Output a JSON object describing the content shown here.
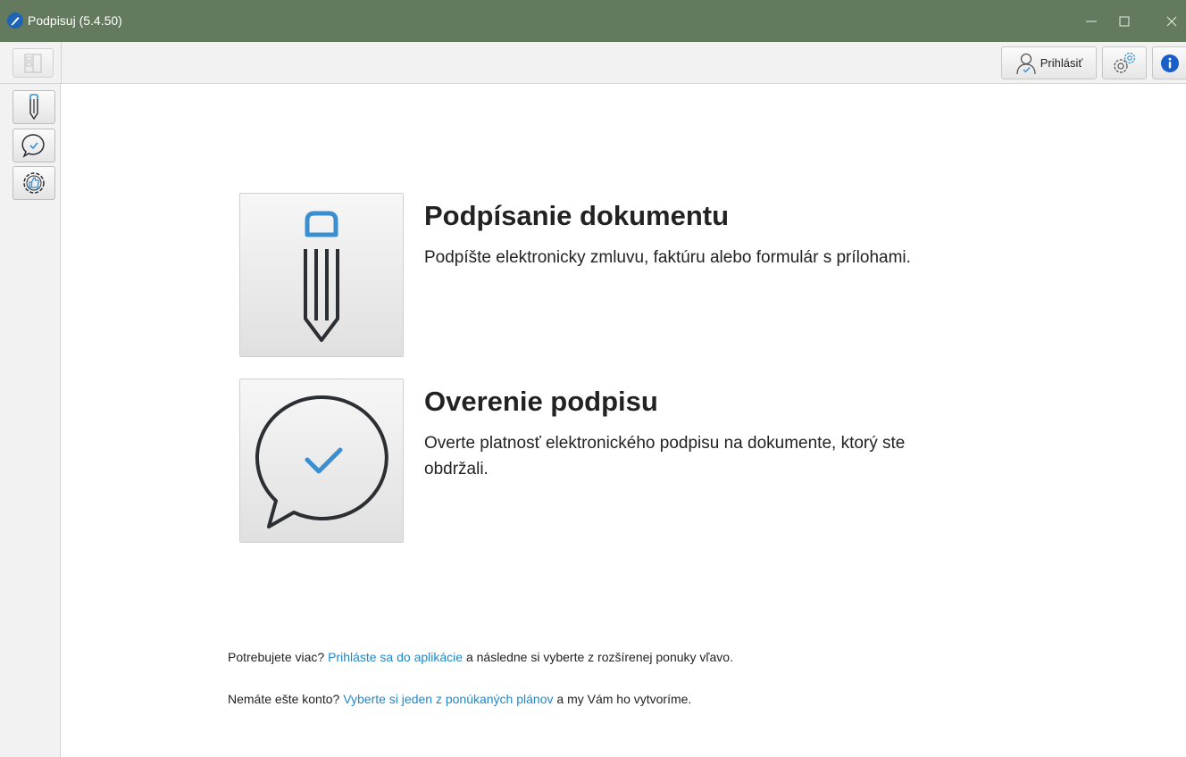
{
  "window": {
    "title": "Podpisuj (5.4.50)"
  },
  "toolbar": {
    "login_label": "Prihlásiť"
  },
  "actions": [
    {
      "title": "Podpísanie dokumentu",
      "description": "Podpíšte elektronicky zmluvu, faktúru alebo formulár s prílohami."
    },
    {
      "title": "Overenie podpisu",
      "description": "Overte platnosť elektronického podpisu na dokumente, ktorý ste obdržali."
    }
  ],
  "footer": {
    "line1": {
      "before": "Potrebujete viac?",
      "link": "Prihláste sa do aplikácie",
      "after": "a následne si vyberte z rozšírenej ponuky vľavo."
    },
    "line2": {
      "before": "Nemáte ešte konto?",
      "link": "Vyberte si jeden z ponúkaných plánov",
      "after": "a my Vám ho vytvoríme."
    }
  },
  "colors": {
    "titlebar": "#647a5f",
    "accent_blue": "#3a8fd1",
    "link": "#1e88c9",
    "icon_dark": "#2b2f33"
  },
  "icons": {
    "app": "pen-nib-icon",
    "toolbar_left": "panel-layout-icon",
    "login": "user-icon",
    "settings": "gears-icon",
    "info": "info-icon",
    "side_sign": "pen-icon",
    "side_verify": "speech-check-icon",
    "side_settings": "gear-thumbs-up-icon"
  }
}
